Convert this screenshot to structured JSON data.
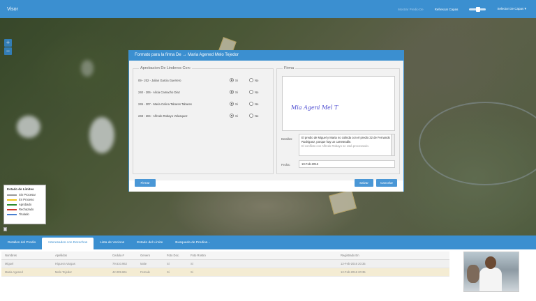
{
  "app": {
    "title": "Visor"
  },
  "topbar": {
    "link_predio": "Mostrar Predio De",
    "refresh": "Refrescar Capas",
    "layers": "Selector De Capas"
  },
  "map": {
    "zoom_in": "+",
    "zoom_out": "−",
    "legend": {
      "title": "Estado de Límites",
      "items": [
        {
          "label": "Sin Procesar",
          "color": "#ffffff"
        },
        {
          "label": "En Proceso",
          "color": "#f0c419"
        },
        {
          "label": "Aprobado",
          "color": "#2e8b2e"
        },
        {
          "label": "Rechazado",
          "color": "#d03a2a"
        },
        {
          "label": "Titulado",
          "color": "#4a7fd0"
        }
      ]
    }
  },
  "modal": {
    "title": "Formato para la firma De → Maria Agened Melo Tejedor",
    "approval": {
      "legend": "Aprobacion De Linderos Con:",
      "yes": "Si",
      "no": "No",
      "rows": [
        {
          "label": "09 - 202 - Julian Garcia Guerrero",
          "value": "Si"
        },
        {
          "label": "240 - 206 - Alicia Camacho Diaz",
          "value": "Si"
        },
        {
          "label": "245 - 207 - Maria Celina Tabares Tabares",
          "value": "Si"
        },
        {
          "label": "248 - 204 - Alfredo Robayo Velasquez",
          "value": "Si"
        }
      ]
    },
    "signature": {
      "legend": "Firma",
      "text": "Mia Ageni Mel T",
      "details_label": "Detalles:",
      "details": "El predio de Miguel y Maria no colinda con el predio 32 de Fernando Rodriguez, porque hay un carreteable.",
      "details_more": "El conflicto con Alfredo Robayo se está procesando.",
      "date_label": "Fecha:",
      "date": "10-Feb-2016"
    },
    "buttons": {
      "sign": "Firmar",
      "save": "Salvar",
      "cancel": "Cancelar"
    }
  },
  "tabs": [
    {
      "label": "Detalles del Predio",
      "active": false
    },
    {
      "label": "Interesados con Derechos",
      "active": true
    },
    {
      "label": "Lista de Vecinos",
      "active": false
    },
    {
      "label": "Estado del Límite",
      "active": false
    },
    {
      "label": "Busqueda de Predios...",
      "active": false
    }
  ],
  "table": {
    "headers": [
      "Nombres",
      "Apellidos",
      "Cedula #",
      "Genero",
      "Foto Doc.",
      "Foto Rostro",
      "Registrado En"
    ],
    "rows": [
      [
        "Miguel",
        "Higuera Vargas",
        "79.610.962",
        "Male",
        "Si",
        "Si",
        "12-Feb-2016 20:35"
      ],
      [
        "Maria Agened",
        "Melo Tejedor",
        "42.009.661",
        "Female",
        "Si",
        "Si",
        "12-Feb-2016 20:35"
      ]
    ]
  }
}
